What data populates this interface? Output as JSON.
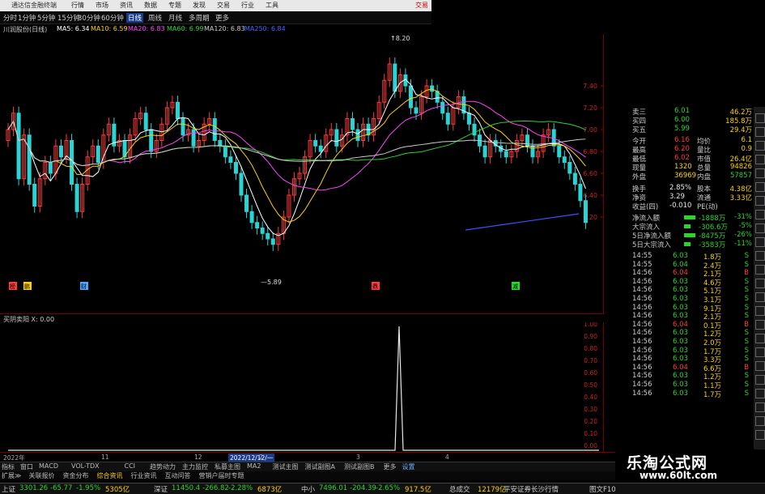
{
  "app": {
    "title": "通达信金融终端",
    "broker": "交易"
  },
  "menu": [
    "行情",
    "市场",
    "资讯",
    "数据",
    "专题",
    "发现",
    "交易",
    "行业",
    "工具"
  ],
  "periods": [
    "分时",
    "1分钟",
    "5分钟",
    "15分钟",
    "30分钟",
    "60分钟",
    "日线",
    "周线",
    "月线",
    "多周期",
    "更多"
  ],
  "periods_active": "日线",
  "ma_bar": {
    "stock": "川润股份(日线)",
    "items": [
      {
        "label": "MA5: 6.34",
        "color": "#ffffff"
      },
      {
        "label": "MA10: 6.59",
        "color": "#ffd200"
      },
      {
        "label": "MA20: 6.83",
        "color": "#ff44ff"
      },
      {
        "label": "MA60: 6.99",
        "color": "#2bd62b"
      },
      {
        "label": "MA120: 6.83",
        "color": "#cccccc"
      },
      {
        "label": "MA250: 6.84",
        "color": "#4466ff"
      }
    ]
  },
  "price_axis": [
    "7.40",
    "7.20",
    "7.00",
    "6.80",
    "6.60",
    "6.40",
    "6.20"
  ],
  "annotations": {
    "high": "8.20",
    "low": "5.89"
  },
  "markers": [
    "榜",
    "鹏",
    "财",
    "鼎",
    "减"
  ],
  "indicator": {
    "label": "买阴卖阳 X: 0.00",
    "axis": [
      "1.00",
      "0.90",
      "0.80",
      "0.70",
      "0.60",
      "0.50",
      "0.40",
      "0.30",
      "0.20",
      "0.10",
      "0.00"
    ]
  },
  "date_axis": {
    "labels": [
      "2022年",
      "11",
      "12",
      "2022/12/12/一",
      "2",
      "3",
      "4"
    ]
  },
  "tabs": [
    "指标",
    "窗口",
    "MACD",
    "VOL-TDX",
    "CCI",
    "趋势动力",
    "主力监控",
    "私募主图",
    "MA2",
    "测试主图",
    "测试副图A",
    "测试副图B",
    "更多",
    "设置"
  ],
  "tabs2": [
    "扩展≫",
    "关联报价",
    "资金分布",
    "综合资讯",
    "行业资讯",
    "互动问答",
    "营销户届时专题"
  ],
  "quote": {
    "top": [
      {
        "l": "卖三",
        "v": "6.01",
        "n": "46.2万"
      },
      {
        "l": "买四",
        "v": "6.00",
        "n": "185.8万"
      },
      {
        "l": "买五",
        "v": "5.99",
        "n": "29.4万"
      }
    ],
    "stats": [
      {
        "l1": "今开",
        "v1": "6.16",
        "l2": "均价",
        "v2": "6.1"
      },
      {
        "l1": "最高",
        "v1": "6.20",
        "l2": "量比",
        "v2": "0.9"
      },
      {
        "l1": "最低",
        "v1": "6.02",
        "l2": "市值",
        "v2": "26.4亿"
      },
      {
        "l1": "现量",
        "v1": "1320",
        "l2": "总量",
        "v2": "94826"
      },
      {
        "l1": "外盘",
        "v1": "36969",
        "l2": "内盘",
        "v2": "57857"
      }
    ],
    "stats2": [
      {
        "l1": "换手",
        "v1": "2.85%",
        "l2": "股本",
        "v2": "4.38亿"
      },
      {
        "l1": "净资",
        "v1": "3.29",
        "l2": "流通",
        "v2": "3.33亿"
      },
      {
        "l1": "收益(四)",
        "v1": "-0.010",
        "l2": "PE(动)",
        "v2": ""
      }
    ],
    "flows": [
      {
        "l": "净流入额",
        "v": "-1888万",
        "p": "-31%"
      },
      {
        "l": "大宗流入",
        "v": "-306.6万",
        "p": "-5%"
      },
      {
        "l": "5日净流入额",
        "v": "-8475万",
        "p": "-26%"
      },
      {
        "l": "5日大宗流入",
        "v": "-3583万",
        "p": "-11%"
      }
    ],
    "ticks": [
      {
        "t": "14:55",
        "p": "6.03",
        "v": "1.8万",
        "s": "S"
      },
      {
        "t": "14:55",
        "p": "6.04",
        "v": "2.4万",
        "s": "S"
      },
      {
        "t": "14:56",
        "p": "6.04",
        "v": "2.1万",
        "s": "B"
      },
      {
        "t": "14:56",
        "p": "6.03",
        "v": "4.6万",
        "s": "S"
      },
      {
        "t": "14:56",
        "p": "6.03",
        "v": "5.1万",
        "s": "S"
      },
      {
        "t": "14:56",
        "p": "6.03",
        "v": "3.1万",
        "s": "S"
      },
      {
        "t": "14:56",
        "p": "6.03",
        "v": "9.1万",
        "s": "S"
      },
      {
        "t": "14:56",
        "p": "6.03",
        "v": "2.1万",
        "s": "S"
      },
      {
        "t": "14:56",
        "p": "6.04",
        "v": "0.1万",
        "s": "B"
      },
      {
        "t": "14:56",
        "p": "6.03",
        "v": "1.2万",
        "s": "S"
      },
      {
        "t": "14:56",
        "p": "6.03",
        "v": "2.0万",
        "s": "S"
      },
      {
        "t": "14:56",
        "p": "6.03",
        "v": "1.7万",
        "s": "S"
      },
      {
        "t": "14:56",
        "p": "6.03",
        "v": "3.3万",
        "s": "S"
      },
      {
        "t": "14:56",
        "p": "6.04",
        "v": "6.6万",
        "s": "B"
      },
      {
        "t": "14:56",
        "p": "6.03",
        "v": "1.2万",
        "s": "S"
      },
      {
        "t": "14:56",
        "p": "6.03",
        "v": "1.1万",
        "s": "S"
      },
      {
        "t": "14:56",
        "p": "6.03",
        "v": "1.7万",
        "s": "S"
      }
    ]
  },
  "right_footer": "图文F10",
  "status": {
    "sh": {
      "name": "上证",
      "v": "3301.26",
      "c": "-65.77",
      "p": "-1.95%",
      "a": "5305亿"
    },
    "sz": {
      "name": "深证",
      "v": "11450.4",
      "c": "-266.82",
      "p": "-2.28%",
      "a": "6873亿"
    },
    "zx": {
      "name": "中小",
      "v": "7496.01",
      "c": "-204.39",
      "p": "-2.65%",
      "a": "917.5亿"
    },
    "total": {
      "label": "总成交",
      "v": "12179亿",
      "note": "平安证券长沙行情"
    }
  },
  "brand": {
    "name": "乐淘公式网",
    "url": "www.60lt.com"
  }
}
